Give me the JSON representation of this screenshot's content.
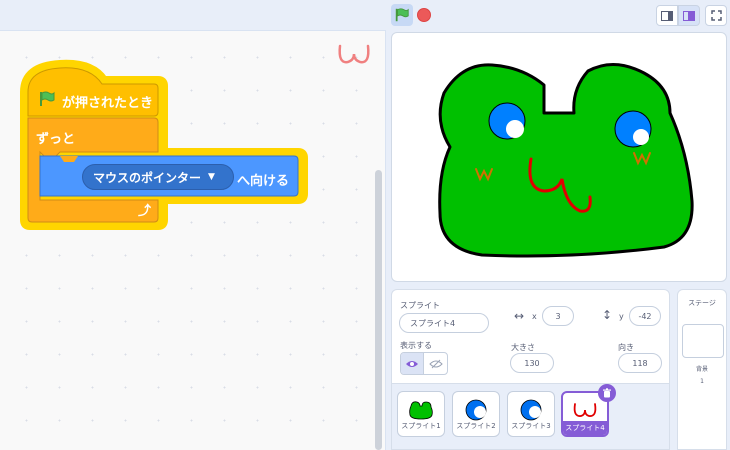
{
  "blocks": {
    "hat_label": "が押されたとき",
    "forever_label": "ずっと",
    "motion_dropdown": "マウスのポインター",
    "motion_label": "へ向ける"
  },
  "sprite_info": {
    "header": "スプライト",
    "name": "スプライト4",
    "x_label": "x",
    "x_value": "3",
    "y_label": "y",
    "y_value": "-42",
    "show_label": "表示する",
    "size_label": "大きさ",
    "size_value": "130",
    "direction_label": "向き",
    "direction_value": "118"
  },
  "sprites": [
    {
      "name": "スプライト1",
      "icon": "frog-icon"
    },
    {
      "name": "スプライト2",
      "icon": "crescent-icon"
    },
    {
      "name": "スプライト3",
      "icon": "crescent-icon"
    },
    {
      "name": "スプライト4",
      "icon": "omega-mouth-icon",
      "selected": true
    }
  ],
  "stage_pane": {
    "header": "ステージ",
    "backdrops_label": "背景",
    "backdrops_count": "1"
  },
  "colors": {
    "events": "#ffbf00",
    "control": "#ffab19",
    "motion": "#4c97ff",
    "frog_green": "#00c000",
    "selection": "#855cd6"
  }
}
